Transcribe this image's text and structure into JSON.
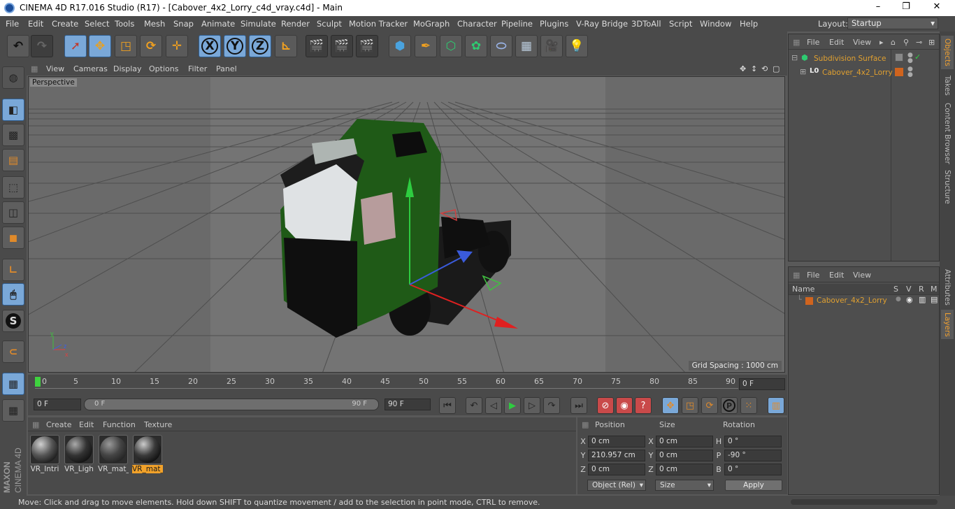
{
  "window": {
    "title": "CINEMA 4D R17.016 Studio (R17) - [Cabover_4x2_Lorry_c4d_vray.c4d] - Main",
    "minimize": "–",
    "maximize": "❐",
    "close": "✕"
  },
  "menu": [
    "File",
    "Edit",
    "Create",
    "Select",
    "Tools",
    "Mesh",
    "Snap",
    "Animate",
    "Simulate",
    "Render",
    "Sculpt",
    "Motion Tracker",
    "MoGraph",
    "Character",
    "Pipeline",
    "Plugins",
    "V-Ray Bridge",
    "3DToAll",
    "Script",
    "Window",
    "Help"
  ],
  "layout": {
    "label": "Layout:",
    "value": "Startup"
  },
  "toolbar": {
    "x": "X",
    "y": "Y",
    "z": "Z"
  },
  "viewport": {
    "menu": [
      "View",
      "Cameras",
      "Display",
      "Options",
      "Filter",
      "Panel"
    ],
    "label": "Perspective",
    "grid_spacing": "Grid Spacing : 1000 cm"
  },
  "timeline": {
    "ticks": [
      "0",
      "5",
      "10",
      "15",
      "20",
      "25",
      "30",
      "35",
      "40",
      "45",
      "50",
      "55",
      "60",
      "65",
      "70",
      "75",
      "80",
      "85",
      "90"
    ],
    "current": "0 F"
  },
  "transport": {
    "start": "0 F",
    "range_start": "0 F",
    "range_end": "90 F",
    "end": "90 F"
  },
  "materials": {
    "menu": [
      "Create",
      "Edit",
      "Function",
      "Texture"
    ],
    "items": [
      {
        "label": "VR_Intri"
      },
      {
        "label": "VR_Ligh"
      },
      {
        "label": "VR_mat_"
      },
      {
        "label": "VR_mat_"
      }
    ]
  },
  "coords": {
    "headers": [
      "Position",
      "Size",
      "Rotation"
    ],
    "rows": [
      {
        "a1": "X",
        "p": "0 cm",
        "a2": "X",
        "s": "0 cm",
        "a3": "H",
        "r": "0 °"
      },
      {
        "a1": "Y",
        "p": "210.957 cm",
        "a2": "Y",
        "s": "0 cm",
        "a3": "P",
        "r": "-90 °"
      },
      {
        "a1": "Z",
        "p": "0 cm",
        "a2": "Z",
        "s": "0 cm",
        "a3": "B",
        "r": "0 °"
      }
    ],
    "mode": "Object (Rel)",
    "size_mode": "Size",
    "apply": "Apply"
  },
  "status": "Move: Click and drag to move elements. Hold down SHIFT to quantize movement / add to the selection in point mode, CTRL to remove.",
  "objects": {
    "menu": [
      "File",
      "Edit",
      "View"
    ],
    "items": [
      {
        "name": "Subdivision Surface"
      },
      {
        "name": "Cabover_4x2_Lorry"
      }
    ]
  },
  "layers": {
    "menu": [
      "File",
      "Edit",
      "View"
    ],
    "columns": [
      "Name",
      "S",
      "V",
      "R",
      "M"
    ],
    "items": [
      {
        "name": "Cabover_4x2_Lorry"
      }
    ]
  },
  "right_tabs": [
    "Objects",
    "Takes",
    "Content Browser",
    "Structure",
    "Attributes",
    "Layers"
  ],
  "brand": {
    "line1": "MAXON",
    "line2": "CINEMA 4D"
  },
  "colors": {
    "accent": "#f2a22a",
    "selected_tool": "#7aa8d8",
    "truck": "#1f5a17"
  }
}
